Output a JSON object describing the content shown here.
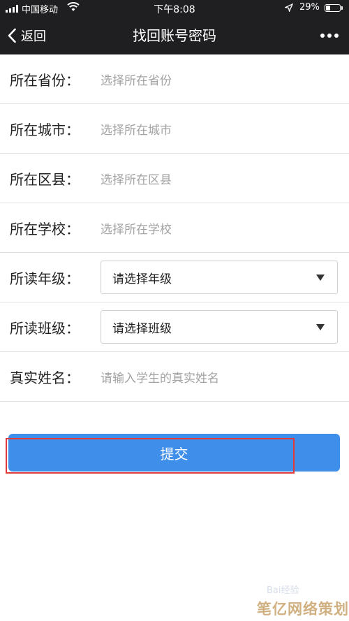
{
  "status_bar": {
    "carrier": "中国移动",
    "time": "下午8:08",
    "battery": "29%",
    "battery_level": 0.29
  },
  "nav": {
    "back_label": "返回",
    "title": "找回账号密码"
  },
  "form": {
    "rows": [
      {
        "label": "所在省份：",
        "placeholder": "选择所在省份"
      },
      {
        "label": "所在城市：",
        "placeholder": "选择所在城市"
      },
      {
        "label": "所在区县：",
        "placeholder": "选择所在区县"
      },
      {
        "label": "所在学校：",
        "placeholder": "选择所在学校"
      },
      {
        "label": "所读年级：",
        "select": "请选择年级"
      },
      {
        "label": "所读班级：",
        "select": "请选择班级"
      },
      {
        "label": "真实姓名：",
        "placeholder": "请输入学生的真实姓名"
      }
    ]
  },
  "submit_label": "提交",
  "watermark": "笔亿网络策划",
  "colors": {
    "header": "#1f1f21",
    "button": "#3f8ee9",
    "annotation": "#e03a3a"
  }
}
